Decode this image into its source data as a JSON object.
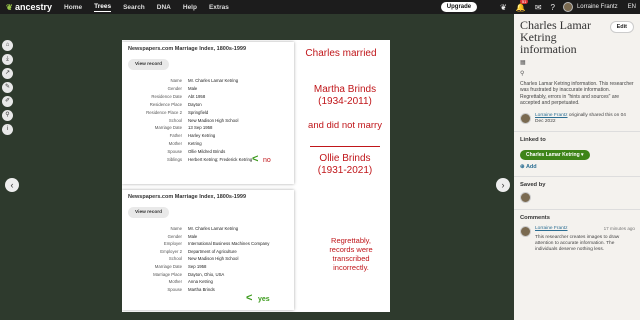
{
  "topnav": {
    "logo": "ancestry",
    "items": [
      "Home",
      "Trees",
      "Search",
      "DNA",
      "Help",
      "Extras"
    ],
    "active": "Trees",
    "upgrade_label": "Upgrade",
    "notification_count": "51",
    "user_name": "Lorraine Frantz",
    "language": "EN"
  },
  "rail_tools": [
    "home-icon",
    "download-icon",
    "share-icon",
    "edit-icon",
    "pen-icon",
    "link-icon",
    "info-icon"
  ],
  "document": {
    "card1": {
      "title": "Newspapers.com Marriage Index, 1800s-1999",
      "button": "View record",
      "rows": [
        {
          "k": "Name",
          "v": "Mr. Charles Lamar Ketring"
        },
        {
          "k": "Gender",
          "v": "Male"
        },
        {
          "k": "Residence Date",
          "v": "Abt 1958"
        },
        {
          "k": "Residence Place",
          "v": "Dayton"
        },
        {
          "k": "Residence Place 2",
          "v": "Springfield"
        },
        {
          "k": "School",
          "v": "New Madison High School"
        },
        {
          "k": "Marriage Date",
          "v": "13 Sep 1958"
        },
        {
          "k": "Father",
          "v": "Harley Ketring"
        },
        {
          "k": "Mother",
          "v": "Ketring"
        },
        {
          "k": "Spouse",
          "v": "Ollie Mildred Brinds"
        },
        {
          "k": "Siblings",
          "v": "Herbert Ketring; Frederick Ketring"
        }
      ]
    },
    "card2": {
      "title": "Newspapers.com Marriage Index, 1800s-1999",
      "button": "View record",
      "rows": [
        {
          "k": "Name",
          "v": "Mr. Charles Lamar Ketring"
        },
        {
          "k": "Gender",
          "v": "Male"
        },
        {
          "k": "Employer",
          "v": "International Business Machines Company"
        },
        {
          "k": "Employer 2",
          "v": "Department of Agriculture"
        },
        {
          "k": "School",
          "v": "New Madison High School"
        },
        {
          "k": "Marriage Date",
          "v": "Sep 1958"
        },
        {
          "k": "Marriage Place",
          "v": "Dayton, Ohio, USA"
        },
        {
          "k": "Mother",
          "v": "Anna Ketring"
        },
        {
          "k": "Spouse",
          "v": "Martha Brinds"
        }
      ]
    },
    "annotations": {
      "n1": "Charles married",
      "n2": "Martha Brinds (1934-2011)",
      "n3": "and did not marry",
      "n4": "Ollie Brinds (1931-2021)",
      "n5": "Regrettably, records were transcribed incorrectly.",
      "no": "no",
      "yes": "yes"
    },
    "colors": {
      "annotation_red": "#c0161a",
      "annotation_green": "#3a9a1a"
    }
  },
  "panel": {
    "title": "Charles Lamar Ketring information",
    "edit_label": "Edit",
    "description": "Charles Lamar Ketring information. This researcher was frustrated by inaccurate information. Regrettably, errors in \"hints and sources\" are accepted and perpetuated.",
    "sharer": "Lorraine Frantz",
    "share_text": "originally shared this on 04 Dec 2022",
    "linked_to_title": "Linked to",
    "linked_tag": "Charles Lamar Ketring",
    "add_label": "Add",
    "saved_by_title": "Saved by",
    "comments_title": "Comments",
    "commenter": "Lorraine Frantz",
    "comment_time": "17 minutes ago",
    "comment_text": "This researcher creates images to draw attention to accurate information. The individuals deserve nothing less."
  }
}
